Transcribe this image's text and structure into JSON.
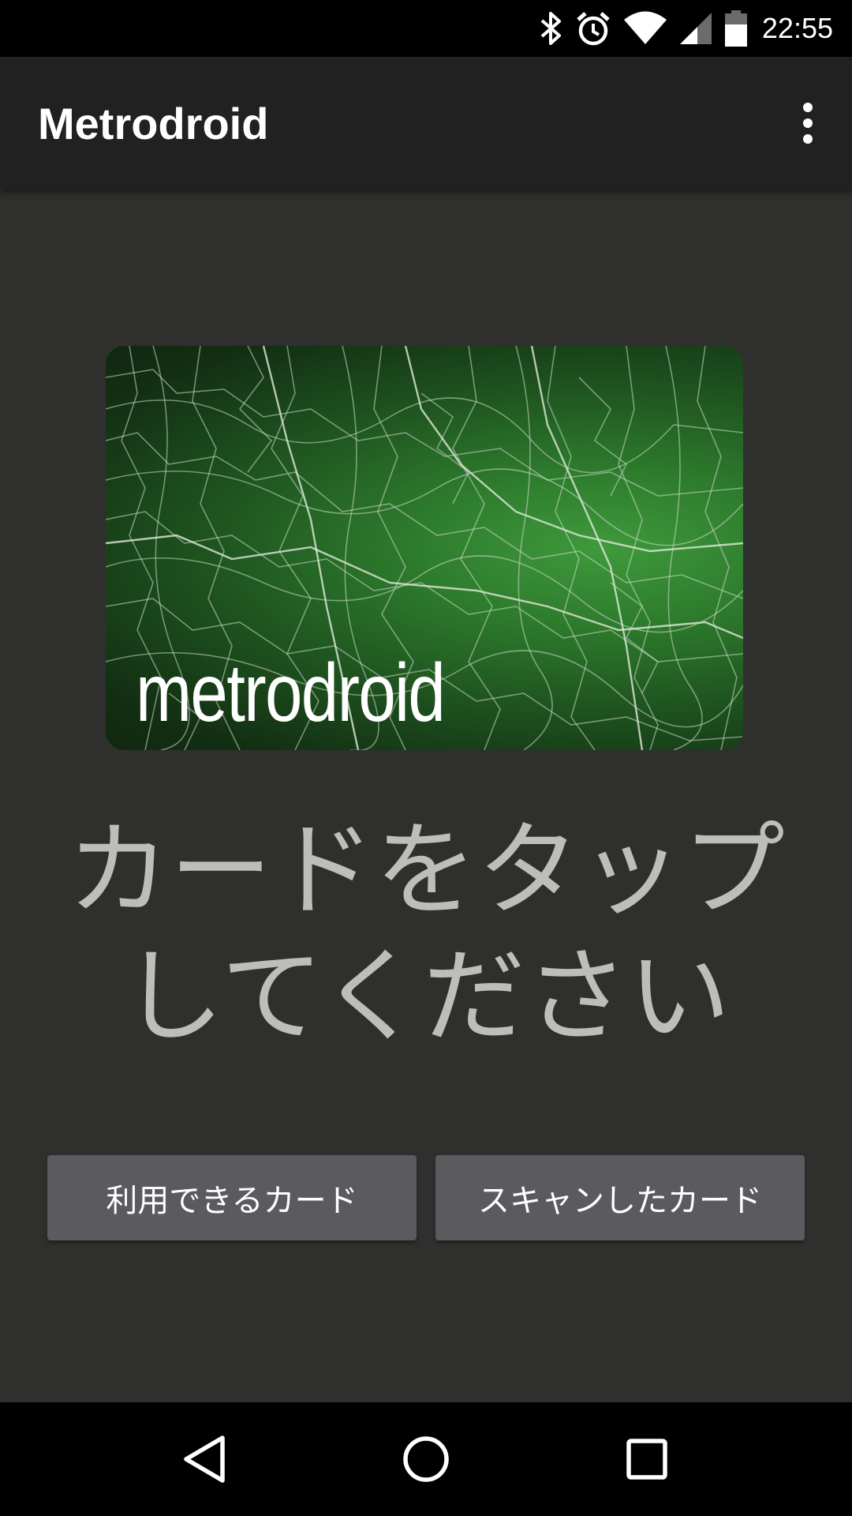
{
  "status_bar": {
    "time": "22:55",
    "icons": [
      "bluetooth-icon",
      "alarm-icon",
      "wifi-icon",
      "signal-icon",
      "battery-icon"
    ]
  },
  "app_bar": {
    "title": "Metrodroid",
    "overflow_icon": "more-vert-icon"
  },
  "main": {
    "card_logo_text": "metrodroid",
    "prompt_line1": "カードをタップ",
    "prompt_line2": "してください",
    "supported_cards_label": "利用できるカード",
    "scanned_cards_label": "スキャンしたカード"
  },
  "nav_bar": {
    "icons": [
      "back-icon",
      "home-icon",
      "recents-icon"
    ]
  },
  "colors": {
    "status_bar_bg": "#000000",
    "app_bar_bg": "#212121",
    "content_bg": "#2f302e",
    "prompt_text": "#bdbebb",
    "button_bg": "#5b5a5e",
    "card_green": "#2d7a2c"
  }
}
